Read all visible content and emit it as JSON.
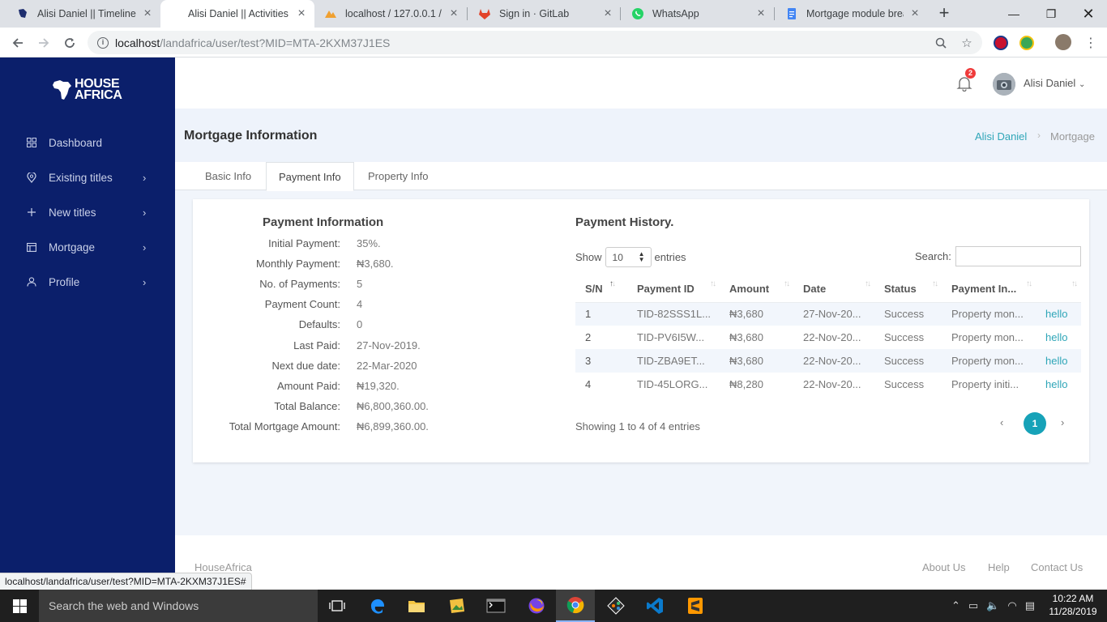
{
  "browser": {
    "tabs": [
      {
        "label": "Alisi Daniel || Timeline",
        "active": false
      },
      {
        "label": "Alisi Daniel || Activities",
        "active": true
      },
      {
        "label": "localhost / 127.0.0.1 / la",
        "active": false
      },
      {
        "label": "Sign in · GitLab",
        "active": false
      },
      {
        "label": "WhatsApp",
        "active": false
      },
      {
        "label": "Mortgage module brea",
        "active": false
      }
    ],
    "url_host": "localhost",
    "url_path": "/landafrica/user/test?MID=MTA-2KXM37J1ES",
    "status_url": "localhost/landafrica/user/test?MID=MTA-2KXM37J1ES#"
  },
  "brand": {
    "line1": "HOUSE",
    "line2": "AFRICA"
  },
  "sidebar": {
    "items": [
      {
        "label": "Dashboard",
        "icon": "grid-icon",
        "has_chevron": false
      },
      {
        "label": "Existing titles",
        "icon": "pin-icon",
        "has_chevron": true
      },
      {
        "label": "New titles",
        "icon": "plus-icon",
        "has_chevron": true
      },
      {
        "label": "Mortgage",
        "icon": "calendar-icon",
        "has_chevron": true
      },
      {
        "label": "Profile",
        "icon": "user-icon",
        "has_chevron": true
      }
    ]
  },
  "topbar": {
    "notification_count": "2",
    "user_name": "Alisi Daniel"
  },
  "page": {
    "title": "Mortgage Information",
    "breadcrumb": {
      "home": "Alisi Daniel",
      "current": "Mortgage"
    },
    "tabs": [
      "Basic Info",
      "Payment Info",
      "Property Info"
    ],
    "active_tab": 1
  },
  "payment_info": {
    "title": "Payment Information",
    "rows": [
      {
        "label": "Initial Payment:",
        "value": "35%."
      },
      {
        "label": "Monthly Payment:",
        "value": "₦3,680."
      },
      {
        "label": "No. of Payments:",
        "value": "5"
      },
      {
        "label": "Payment Count:",
        "value": "4"
      },
      {
        "label": "Defaults:",
        "value": "0"
      },
      {
        "label": "Last Paid:",
        "value": "27-Nov-2019."
      },
      {
        "label": "Next due date:",
        "value": "22-Mar-2020"
      },
      {
        "label": "Amount Paid:",
        "value": "₦19,320."
      },
      {
        "label": "Total Balance:",
        "value": "₦6,800,360.00."
      },
      {
        "label": "Total Mortgage Amount:",
        "value": "₦6,899,360.00."
      }
    ]
  },
  "payment_history": {
    "title": "Payment History.",
    "show_label": "Show",
    "entries_label": "entries",
    "page_length": "10",
    "search_label": "Search:",
    "columns": [
      "S/N",
      "Payment ID",
      "Amount",
      "Date",
      "Status",
      "Payment In...",
      ""
    ],
    "rows": [
      {
        "sn": "1",
        "id": "TID-82SSS1L...",
        "amount": "₦3,680",
        "date": "27-Nov-20...",
        "status": "Success",
        "info": "Property mon...",
        "action": "hello"
      },
      {
        "sn": "2",
        "id": "TID-PV6I5W...",
        "amount": "₦3,680",
        "date": "22-Nov-20...",
        "status": "Success",
        "info": "Property mon...",
        "action": "hello"
      },
      {
        "sn": "3",
        "id": "TID-ZBA9ET...",
        "amount": "₦3,680",
        "date": "22-Nov-20...",
        "status": "Success",
        "info": "Property mon...",
        "action": "hello"
      },
      {
        "sn": "4",
        "id": "TID-45LORG...",
        "amount": "₦8,280",
        "date": "22-Nov-20...",
        "status": "Success",
        "info": "Property initi...",
        "action": "hello"
      }
    ],
    "summary": "Showing 1 to 4 of 4 entries",
    "current_page": "1"
  },
  "footer": {
    "brand": "HouseAfrica",
    "links": [
      "About Us",
      "Help",
      "Contact Us"
    ]
  },
  "taskbar": {
    "search_placeholder": "Search the web and Windows",
    "time": "10:22 AM",
    "date": "11/28/2019"
  },
  "colors": {
    "sidebar": "#0b1f6b",
    "accent": "#17a2b8",
    "link": "#2fa6b8"
  }
}
